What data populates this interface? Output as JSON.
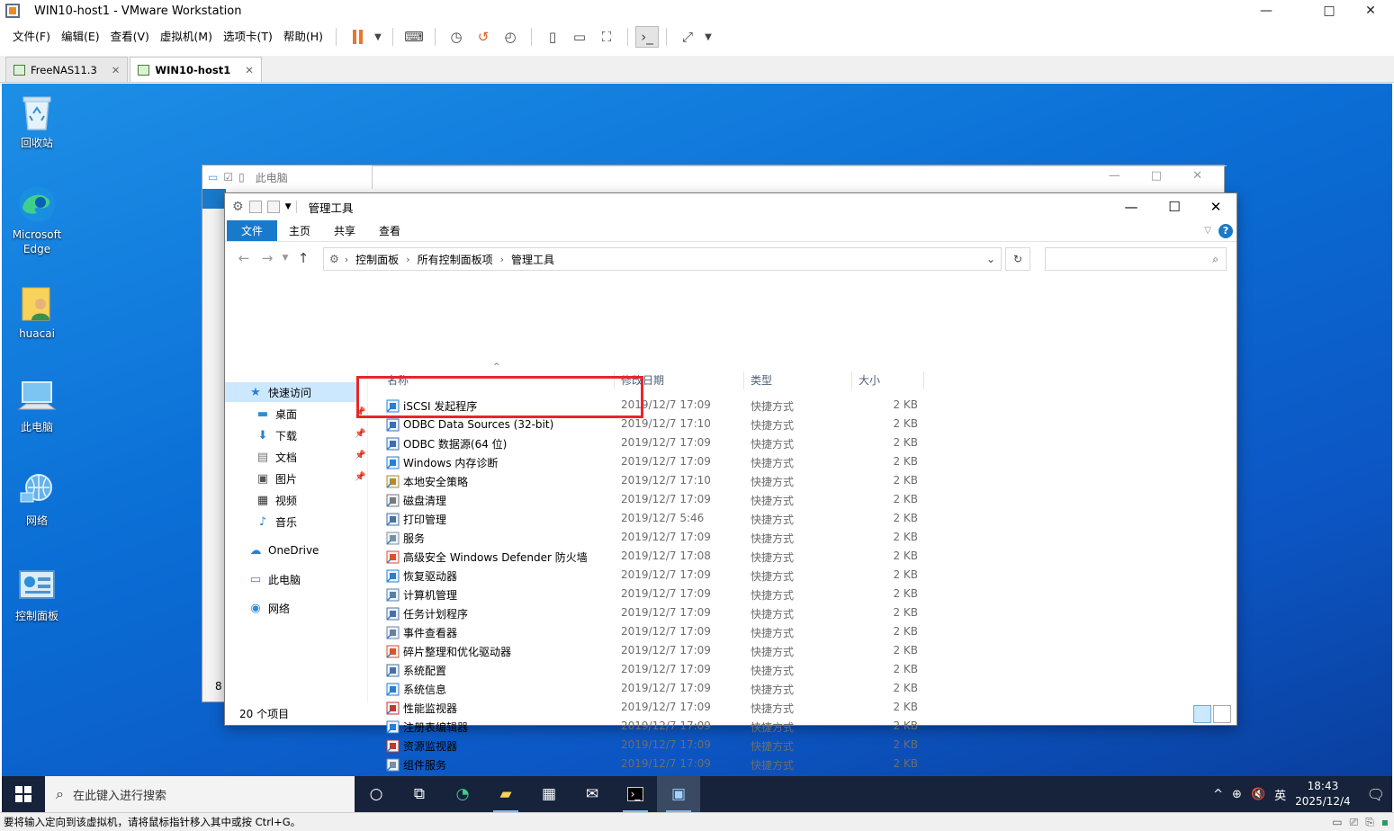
{
  "vm": {
    "title": "WIN10-host1 - VMware Workstation",
    "menu": [
      "文件(F)",
      "编辑(E)",
      "查看(V)",
      "虚拟机(M)",
      "选项卡(T)",
      "帮助(H)"
    ],
    "tabs": [
      {
        "label": "FreeNAS11.3",
        "active": false
      },
      {
        "label": "WIN10-host1",
        "active": true
      }
    ],
    "status_text": "要将输入定向到该虚拟机，请将鼠标指针移入其中或按 Ctrl+G。"
  },
  "desktop_icons": [
    {
      "label": "回收站",
      "icon": "recycle-bin-icon"
    },
    {
      "label": "Microsoft Edge",
      "icon": "edge-icon"
    },
    {
      "label": "huacai",
      "icon": "user-folder-icon"
    },
    {
      "label": "此电脑",
      "icon": "computer-icon"
    },
    {
      "label": "网络",
      "icon": "network-icon"
    },
    {
      "label": "控制面板",
      "icon": "control-panel-icon"
    }
  ],
  "bg_window": {
    "title": "此电脑",
    "corner_text": "8"
  },
  "explorer": {
    "title": "管理工具",
    "ribbon_tabs": [
      "文件",
      "主页",
      "共享",
      "查看"
    ],
    "breadcrumb": [
      "控制面板",
      "所有控制面板项",
      "管理工具"
    ],
    "search_placeholder": "",
    "nav": {
      "quick_access": "快速访问",
      "items": [
        "桌面",
        "下载",
        "文档",
        "图片",
        "视频",
        "音乐"
      ],
      "onedrive": "OneDrive",
      "this_pc": "此电脑",
      "network": "网络"
    },
    "columns": {
      "name": "名称",
      "date": "修改日期",
      "type": "类型",
      "size": "大小"
    },
    "files": [
      {
        "name": "iSCSI 发起程序",
        "date": "2019/12/7 17:09",
        "type": "快捷方式",
        "size": "2 KB"
      },
      {
        "name": "ODBC Data Sources (32-bit)",
        "date": "2019/12/7 17:10",
        "type": "快捷方式",
        "size": "2 KB"
      },
      {
        "name": "ODBC 数据源(64 位)",
        "date": "2019/12/7 17:09",
        "type": "快捷方式",
        "size": "2 KB"
      },
      {
        "name": "Windows 内存诊断",
        "date": "2019/12/7 17:09",
        "type": "快捷方式",
        "size": "2 KB"
      },
      {
        "name": "本地安全策略",
        "date": "2019/12/7 17:10",
        "type": "快捷方式",
        "size": "2 KB"
      },
      {
        "name": "磁盘清理",
        "date": "2019/12/7 17:09",
        "type": "快捷方式",
        "size": "2 KB"
      },
      {
        "name": "打印管理",
        "date": "2019/12/7 5:46",
        "type": "快捷方式",
        "size": "2 KB"
      },
      {
        "name": "服务",
        "date": "2019/12/7 17:09",
        "type": "快捷方式",
        "size": "2 KB"
      },
      {
        "name": "高级安全 Windows Defender 防火墙",
        "date": "2019/12/7 17:08",
        "type": "快捷方式",
        "size": "2 KB"
      },
      {
        "name": "恢复驱动器",
        "date": "2019/12/7 17:09",
        "type": "快捷方式",
        "size": "2 KB"
      },
      {
        "name": "计算机管理",
        "date": "2019/12/7 17:09",
        "type": "快捷方式",
        "size": "2 KB"
      },
      {
        "name": "任务计划程序",
        "date": "2019/12/7 17:09",
        "type": "快捷方式",
        "size": "2 KB"
      },
      {
        "name": "事件查看器",
        "date": "2019/12/7 17:09",
        "type": "快捷方式",
        "size": "2 KB"
      },
      {
        "name": "碎片整理和优化驱动器",
        "date": "2019/12/7 17:09",
        "type": "快捷方式",
        "size": "2 KB"
      },
      {
        "name": "系统配置",
        "date": "2019/12/7 17:09",
        "type": "快捷方式",
        "size": "2 KB"
      },
      {
        "name": "系统信息",
        "date": "2019/12/7 17:09",
        "type": "快捷方式",
        "size": "2 KB"
      },
      {
        "name": "性能监视器",
        "date": "2019/12/7 17:09",
        "type": "快捷方式",
        "size": "2 KB"
      },
      {
        "name": "注册表编辑器",
        "date": "2019/12/7 17:09",
        "type": "快捷方式",
        "size": "2 KB"
      },
      {
        "name": "资源监视器",
        "date": "2019/12/7 17:09",
        "type": "快捷方式",
        "size": "2 KB"
      },
      {
        "name": "组件服务",
        "date": "2019/12/7 17:09",
        "type": "快捷方式",
        "size": "2 KB"
      }
    ],
    "status": "20 个项目"
  },
  "taskbar": {
    "search_placeholder": "在此键入进行搜索",
    "ime": "英",
    "time": "18:43",
    "date": "2025/12/4"
  },
  "colors": {
    "accent": "#1979ca",
    "highlight": "#e8262a",
    "taskbar": "#16233a",
    "vm_pause": "#e8772e"
  }
}
